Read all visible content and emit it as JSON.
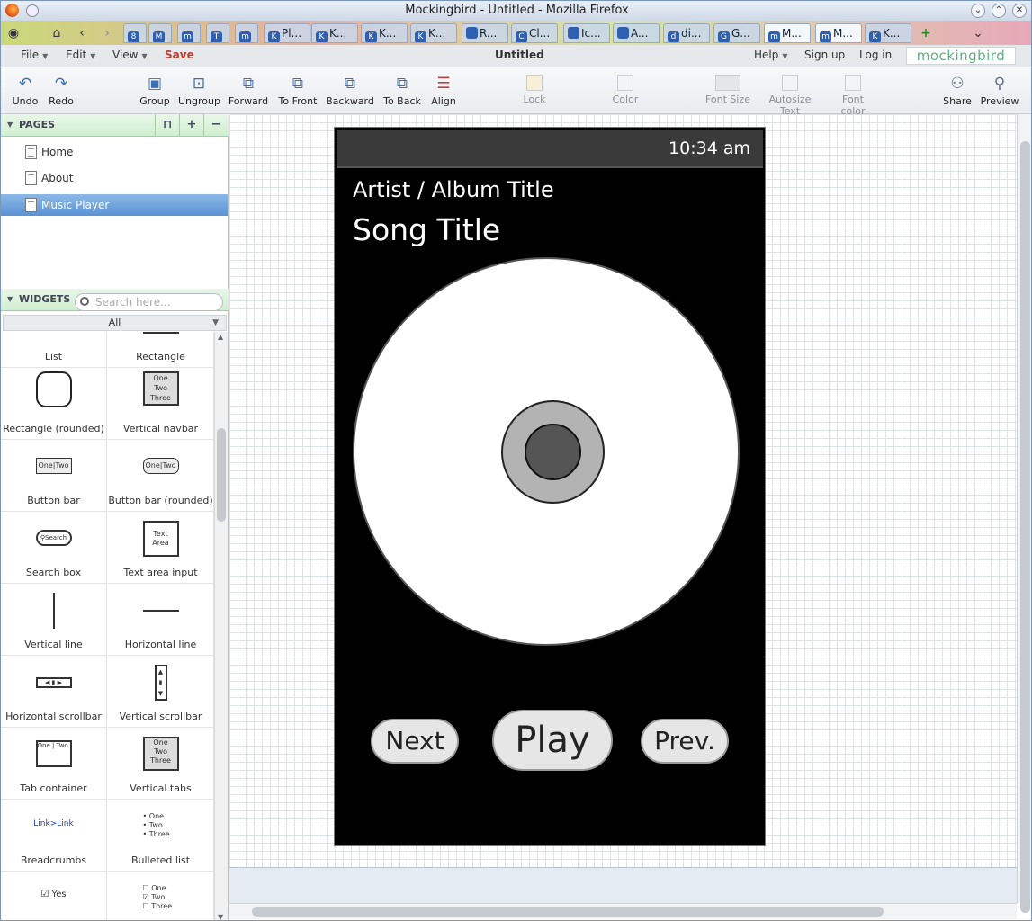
{
  "window": {
    "title": "Mockingbird - Untitled - Mozilla Firefox"
  },
  "tabs": [
    {
      "icon": "8",
      "label": ""
    },
    {
      "icon": "M",
      "label": ""
    },
    {
      "icon": "m",
      "label": ""
    },
    {
      "icon": "T",
      "label": ""
    },
    {
      "icon": "m",
      "label": ""
    },
    {
      "icon": "K",
      "label": "Pl..."
    },
    {
      "icon": "K",
      "label": "K..."
    },
    {
      "icon": "K",
      "label": "K..."
    },
    {
      "icon": "K",
      "label": "K..."
    },
    {
      "icon": "",
      "label": "R..."
    },
    {
      "icon": "C",
      "label": "Cl..."
    },
    {
      "icon": "",
      "label": "Ic..."
    },
    {
      "icon": "",
      "label": "A..."
    },
    {
      "icon": "d",
      "label": "di..."
    },
    {
      "icon": "G",
      "label": "G..."
    },
    {
      "icon": "m",
      "label": "M..."
    },
    {
      "icon": "m",
      "label": "M..."
    },
    {
      "icon": "K",
      "label": "K..."
    }
  ],
  "menubar": {
    "file": "File",
    "edit": "Edit",
    "view": "View",
    "save": "Save",
    "doc_title": "Untitled",
    "help": "Help",
    "signup": "Sign up",
    "login": "Log in",
    "brand": "mockingbird"
  },
  "toolbar": {
    "undo": "Undo",
    "redo": "Redo",
    "group": "Group",
    "ungroup": "Ungroup",
    "forward": "Forward",
    "to_front": "To Front",
    "backward": "Backward",
    "to_back": "To Back",
    "align": "Align",
    "lock": "Lock",
    "color": "Color",
    "font_size": "Font Size",
    "autosize": "Autosize Text",
    "font_color": "Font color",
    "share": "Share",
    "preview": "Preview"
  },
  "pages_panel": {
    "title": "PAGES",
    "items": [
      "Home",
      "About",
      "Music Player"
    ],
    "selected": "Music Player"
  },
  "widgets_panel": {
    "title": "WIDGETS",
    "search_placeholder": "Search here...",
    "filter": "All",
    "items": [
      "List",
      "Rectangle",
      "Rectangle (rounded)",
      "Vertical navbar",
      "Button bar",
      "Button bar (rounded)",
      "Search box",
      "Text area input",
      "Vertical line",
      "Horizontal line",
      "Horizontal scrollbar",
      "Vertical scrollbar",
      "Tab container",
      "Vertical tabs",
      "Breadcrumbs",
      "Bulleted list"
    ],
    "glyph_text": {
      "one": "One",
      "two": "Two",
      "three": "Three",
      "search": "Search",
      "text_area": "Text Area",
      "link": "Link",
      "yes": "Yes"
    }
  },
  "mockup": {
    "time": "10:34 am",
    "artist_album": "Artist / Album Title",
    "song_title": "Song Title",
    "next": "Next",
    "play": "Play",
    "prev": "Prev."
  }
}
